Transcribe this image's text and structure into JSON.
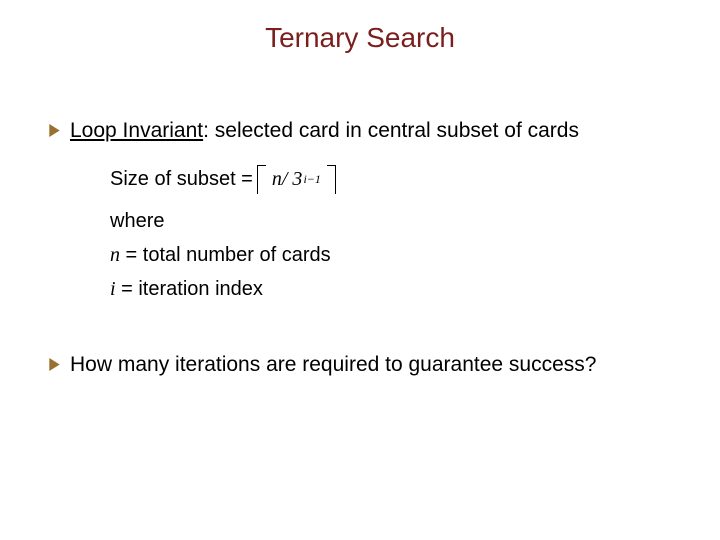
{
  "title": "Ternary Search",
  "bullets": [
    {
      "lead": "Loop Invariant",
      "rest": ":  selected card in central subset of cards"
    },
    {
      "text": "How many iterations are required to guarantee success?"
    }
  ],
  "math": {
    "size_label": "Size of subset = ",
    "ceil_expr_n": "n",
    "ceil_expr_slash": " / 3",
    "ceil_expr_sup": "i−1",
    "where": "where",
    "n_sym": "n",
    "n_def": " = total number of cards",
    "i_sym": "i",
    "i_def": " = iteration index"
  },
  "icons": {
    "chevron": "chevron-right-icon"
  }
}
